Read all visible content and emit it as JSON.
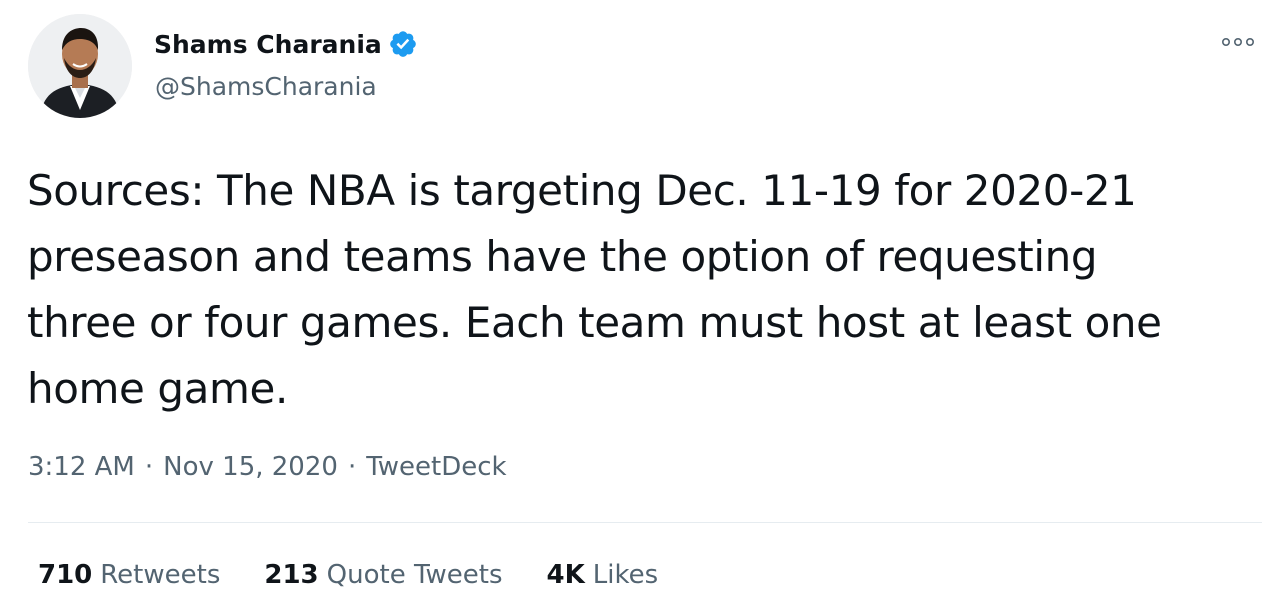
{
  "author": {
    "display_name": "Shams Charania",
    "handle": "@ShamsCharania",
    "verified": true,
    "verified_icon": "verified-badge-icon"
  },
  "tweet": {
    "text": "Sources: The NBA is targeting Dec. 11-19 for 2020-21\npreseason and teams have the option of requesting\nthree or four games. Each team must host at least one\nhome game."
  },
  "meta": {
    "time": "3:12 AM",
    "separator": "·",
    "date": "Nov 15, 2020",
    "source": "TweetDeck"
  },
  "stats": {
    "retweets_count": "710",
    "retweets_label": "Retweets",
    "quotes_count": "213",
    "quotes_label": "Quote Tweets",
    "likes_count": "4K",
    "likes_label": "Likes"
  },
  "icons": {
    "more": "more-options-icon",
    "avatar": "profile-avatar"
  },
  "colors": {
    "text_primary": "#0f1419",
    "text_secondary": "#536471",
    "verified_blue": "#1d9bf0",
    "divider": "#e6ecf0"
  }
}
